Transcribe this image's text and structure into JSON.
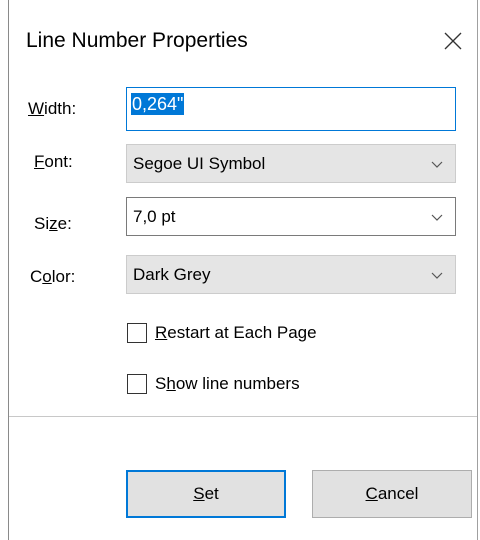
{
  "dialog": {
    "title": "Line Number Properties",
    "close_icon": "close-icon"
  },
  "fields": {
    "width": {
      "label_mnemonic": "W",
      "label_rest": "idth:",
      "value": "0,264\""
    },
    "font": {
      "label_mnemonic": "F",
      "label_rest": "ont:",
      "value": "Segoe UI Symbol"
    },
    "size": {
      "label_prefix": "Si",
      "label_mnemonic": "z",
      "label_rest": "e:",
      "value": "7,0 pt"
    },
    "color": {
      "label_prefix": "C",
      "label_mnemonic": "o",
      "label_rest": "lor:",
      "value": "Dark Grey"
    }
  },
  "options": {
    "restart": {
      "label_mnemonic": "R",
      "label_rest": "estart at Each Page",
      "checked": false
    },
    "show": {
      "label_prefix": "S",
      "label_mnemonic": "h",
      "label_rest": "ow line numbers",
      "checked": false
    }
  },
  "buttons": {
    "set": {
      "label_mnemonic": "S",
      "label_rest": "et"
    },
    "cancel": {
      "label_mnemonic": "C",
      "label_rest": "ancel"
    }
  },
  "colors": {
    "accent": "#0078d7",
    "disabled_field_bg": "#e5e5e5",
    "button_bg": "#e1e1e1"
  }
}
